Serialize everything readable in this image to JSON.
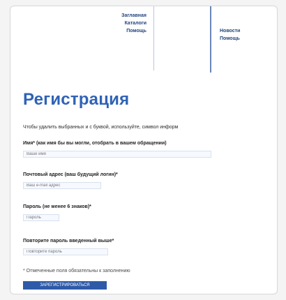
{
  "nav": {
    "left_links": [
      "Заглавная",
      "Каталоги",
      "Помощь"
    ],
    "right_links": [
      "Новости",
      "Помощь"
    ]
  },
  "form": {
    "title": "Регистрация",
    "intro": "Чтобы удалить выбранных и с буквой, используйте, символ информ",
    "fields": [
      {
        "label": "Имя* (как имя бы вы могли, отобрать в вашем обращении)",
        "placeholder": "Ваше имя",
        "width": "wide"
      },
      {
        "label": "Почтовый адрес (ваш будущий логин)*",
        "placeholder": "Ваш e-mail адрес",
        "width": "medium"
      },
      {
        "label": "Пароль (не менее 6 знаков)*",
        "placeholder": "Пароль",
        "width": "small"
      },
      {
        "label": "Повторите пароль введенный выше*",
        "placeholder": "Повторите пароль",
        "width": "medium"
      }
    ],
    "required_note": "* Отмеченные поля обязательны к заполнению",
    "submit_label": "ЗАРЕГИСТРИРОВАТЬСЯ"
  }
}
